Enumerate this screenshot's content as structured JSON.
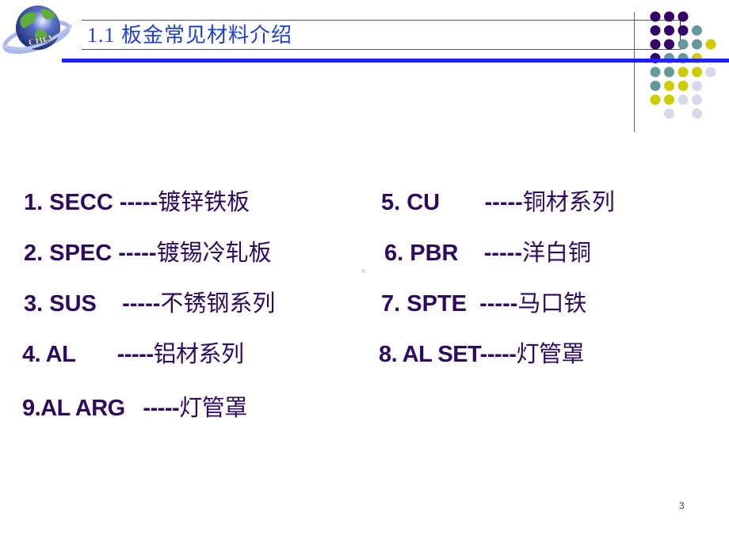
{
  "header": {
    "logo_text": "CHIA",
    "title": "1.1   板金常见材料介绍"
  },
  "colors": {
    "title": "#1f3fd0",
    "accent_bar": "#1a24ff",
    "body_text": "#2e0a5e",
    "dot_purple": "#330066",
    "dot_teal": "#669999",
    "dot_yellow": "#cccc00",
    "dot_lavender": "#d8d8ea"
  },
  "materials": [
    {
      "code": "1. SECC -----",
      "name": "镀锌铁板"
    },
    {
      "code": "2. SPEC -----",
      "name": "镀锡冷轧板"
    },
    {
      "code": "3. SUS    -----",
      "name": "不锈钢系列"
    },
    {
      "code": "4. AL       -----",
      "name": "铝材系列"
    },
    {
      "code": "5. CU       -----",
      "name": "铜材系列"
    },
    {
      "code": "6. PBR    -----",
      "name": "洋白铜"
    },
    {
      "code": "7. SPTE  -----",
      "name": "马口铁"
    },
    {
      "code": "8. AL SET-----",
      "name": "灯管罩"
    },
    {
      "code": "9.AL ARG   -----",
      "name": "灯管罩"
    }
  ],
  "footer": {
    "page_number": "3"
  }
}
